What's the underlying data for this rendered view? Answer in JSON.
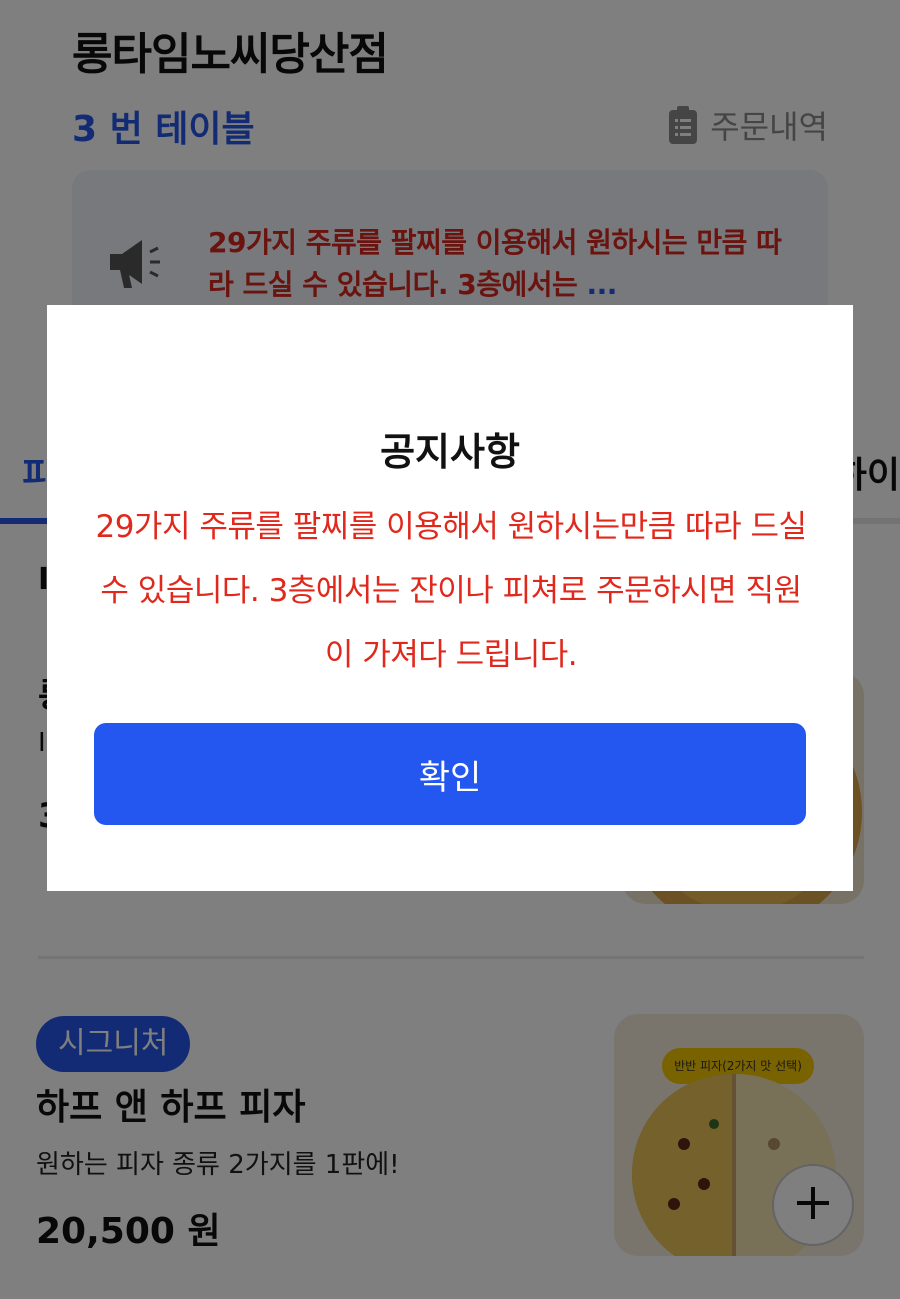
{
  "header": {
    "store_name": "롱타임노씨당산점",
    "table_label": "3 번 테이블",
    "order_history_label": "주문내역",
    "order_history_icon": "clipboard-icon"
  },
  "notice_banner": {
    "icon": "megaphone-icon",
    "text": "29가지 주류를 팔찌를 이용해서 원하시는 만큼 따라 드실 수 있습니다. 3층에서는",
    "more": "..."
  },
  "tabs": {
    "left_partial": "피",
    "right_partial": "하이"
  },
  "menu_partial": {
    "section_char": "I",
    "item1_char1": "롱",
    "item1_char2": "I",
    "item1_char3": "3"
  },
  "menu_items": [
    {
      "badge": "시그니처",
      "name": "하프 앤 하프 피자",
      "description": "원하는 피자 종류 2가지를 1판에!",
      "price": "20,500 원",
      "image_tag": "반반 피자(2가지 맛 선택)",
      "add_icon": "plus-icon"
    }
  ],
  "modal": {
    "title": "공지사항",
    "body": " 29가지 주류를 팔찌를 이용해서 원하시는만큼 따라 드실 수 있습니다. 3층에서는 잔이나 피쳐로 주문하시면 직원이 가져다 드립니다.",
    "confirm_label": "확인"
  },
  "colors": {
    "accent_blue": "#2456e8",
    "notice_red": "#e0281c",
    "badge_blue": "#2456e8",
    "overlay": "rgba(0,0,0,0.5)"
  }
}
